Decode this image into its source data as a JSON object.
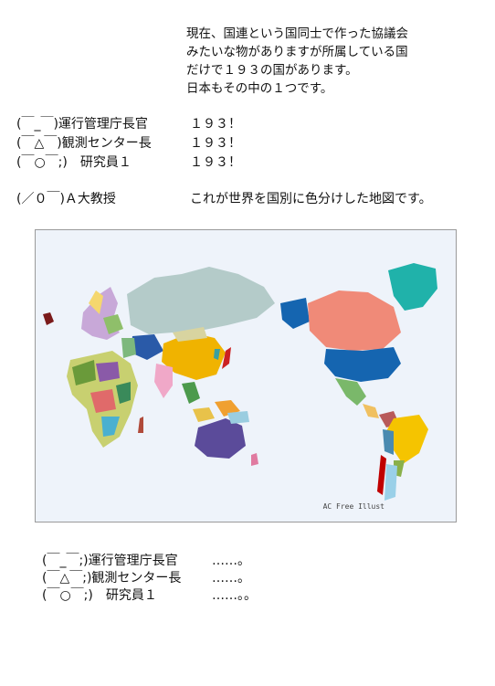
{
  "intro": {
    "lines": [
      "現在、国連という国同士で作った協議会",
      "みたいな物がありますが所属している国",
      "だけで１９３の国があります。",
      "日本もその中の１つです。"
    ]
  },
  "dialogue": [
    {
      "speaker": "(￣_￣)運行管理庁長官",
      "line": "１９３！"
    },
    {
      "speaker": "(￣△￣)観測センター長",
      "line": "１９３！"
    },
    {
      "speaker": "(￣○￣;)　研究員１",
      "line": "１９３！"
    }
  ],
  "professor": {
    "speaker": "(／０￣)Ａ大教授",
    "line": "これが世界を国別に色分けした地図です。"
  },
  "map": {
    "credit": "AC Free Illust"
  },
  "closing": [
    {
      "speaker": "(￣_￣;)運行管理庁長官",
      "line": "……。"
    },
    {
      "speaker": "(￣△￣;)観測センター長",
      "line": "……。"
    },
    {
      "speaker": "(￣○￣;)　研究員１",
      "line": "……。。"
    }
  ],
  "colors": {
    "ocean": "#eef3fa",
    "russia": "#b4cbc9",
    "china": "#f0b300",
    "canada": "#f08a78",
    "usa": "#1565b0",
    "greenland": "#20b2aa",
    "australia": "#5b4b9a",
    "brazil": "#f5c400",
    "chile": "#c00000"
  }
}
